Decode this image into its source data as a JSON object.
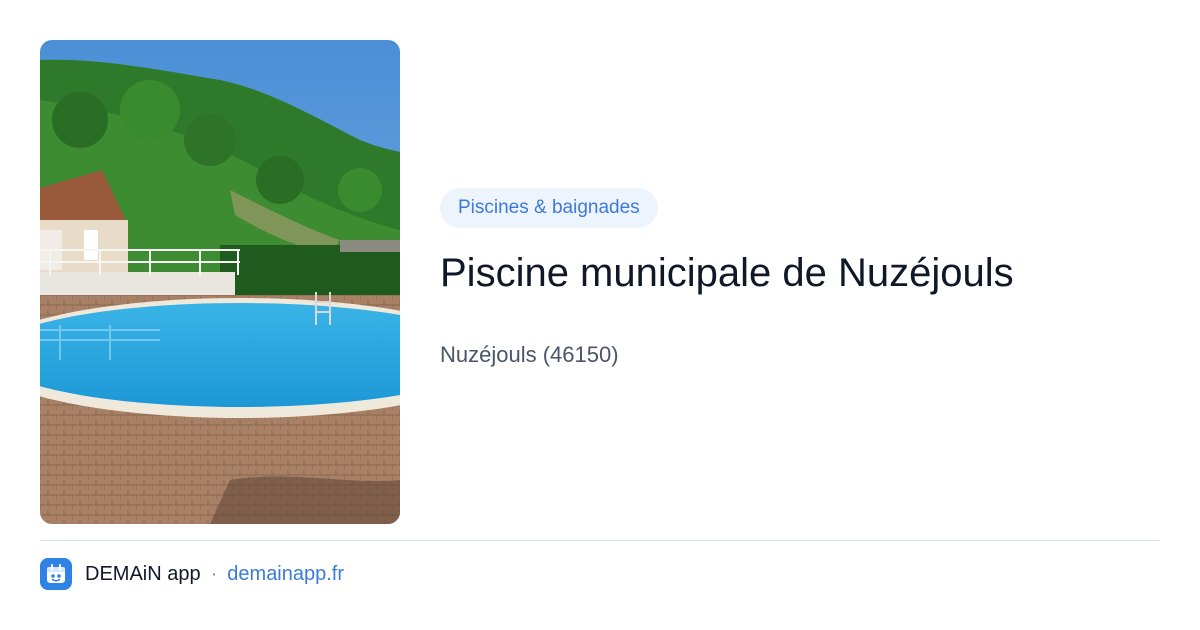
{
  "card": {
    "image_alt": "Piscine municipale de Nuzéjouls",
    "category": "Piscines & baignades",
    "title": "Piscine municipale de Nuzéjouls",
    "location": "Nuzéjouls (46150)"
  },
  "footer": {
    "app_name": "DEMAiN app",
    "separator": "·",
    "domain": "demainapp.fr",
    "logo_icon": "demain-app-logo-icon"
  },
  "colors": {
    "accent": "#3b7ad9",
    "badge_bg": "#eef4fd",
    "title": "#101828",
    "subtitle": "#4a5568",
    "logo_bg": "#2f83e6"
  }
}
